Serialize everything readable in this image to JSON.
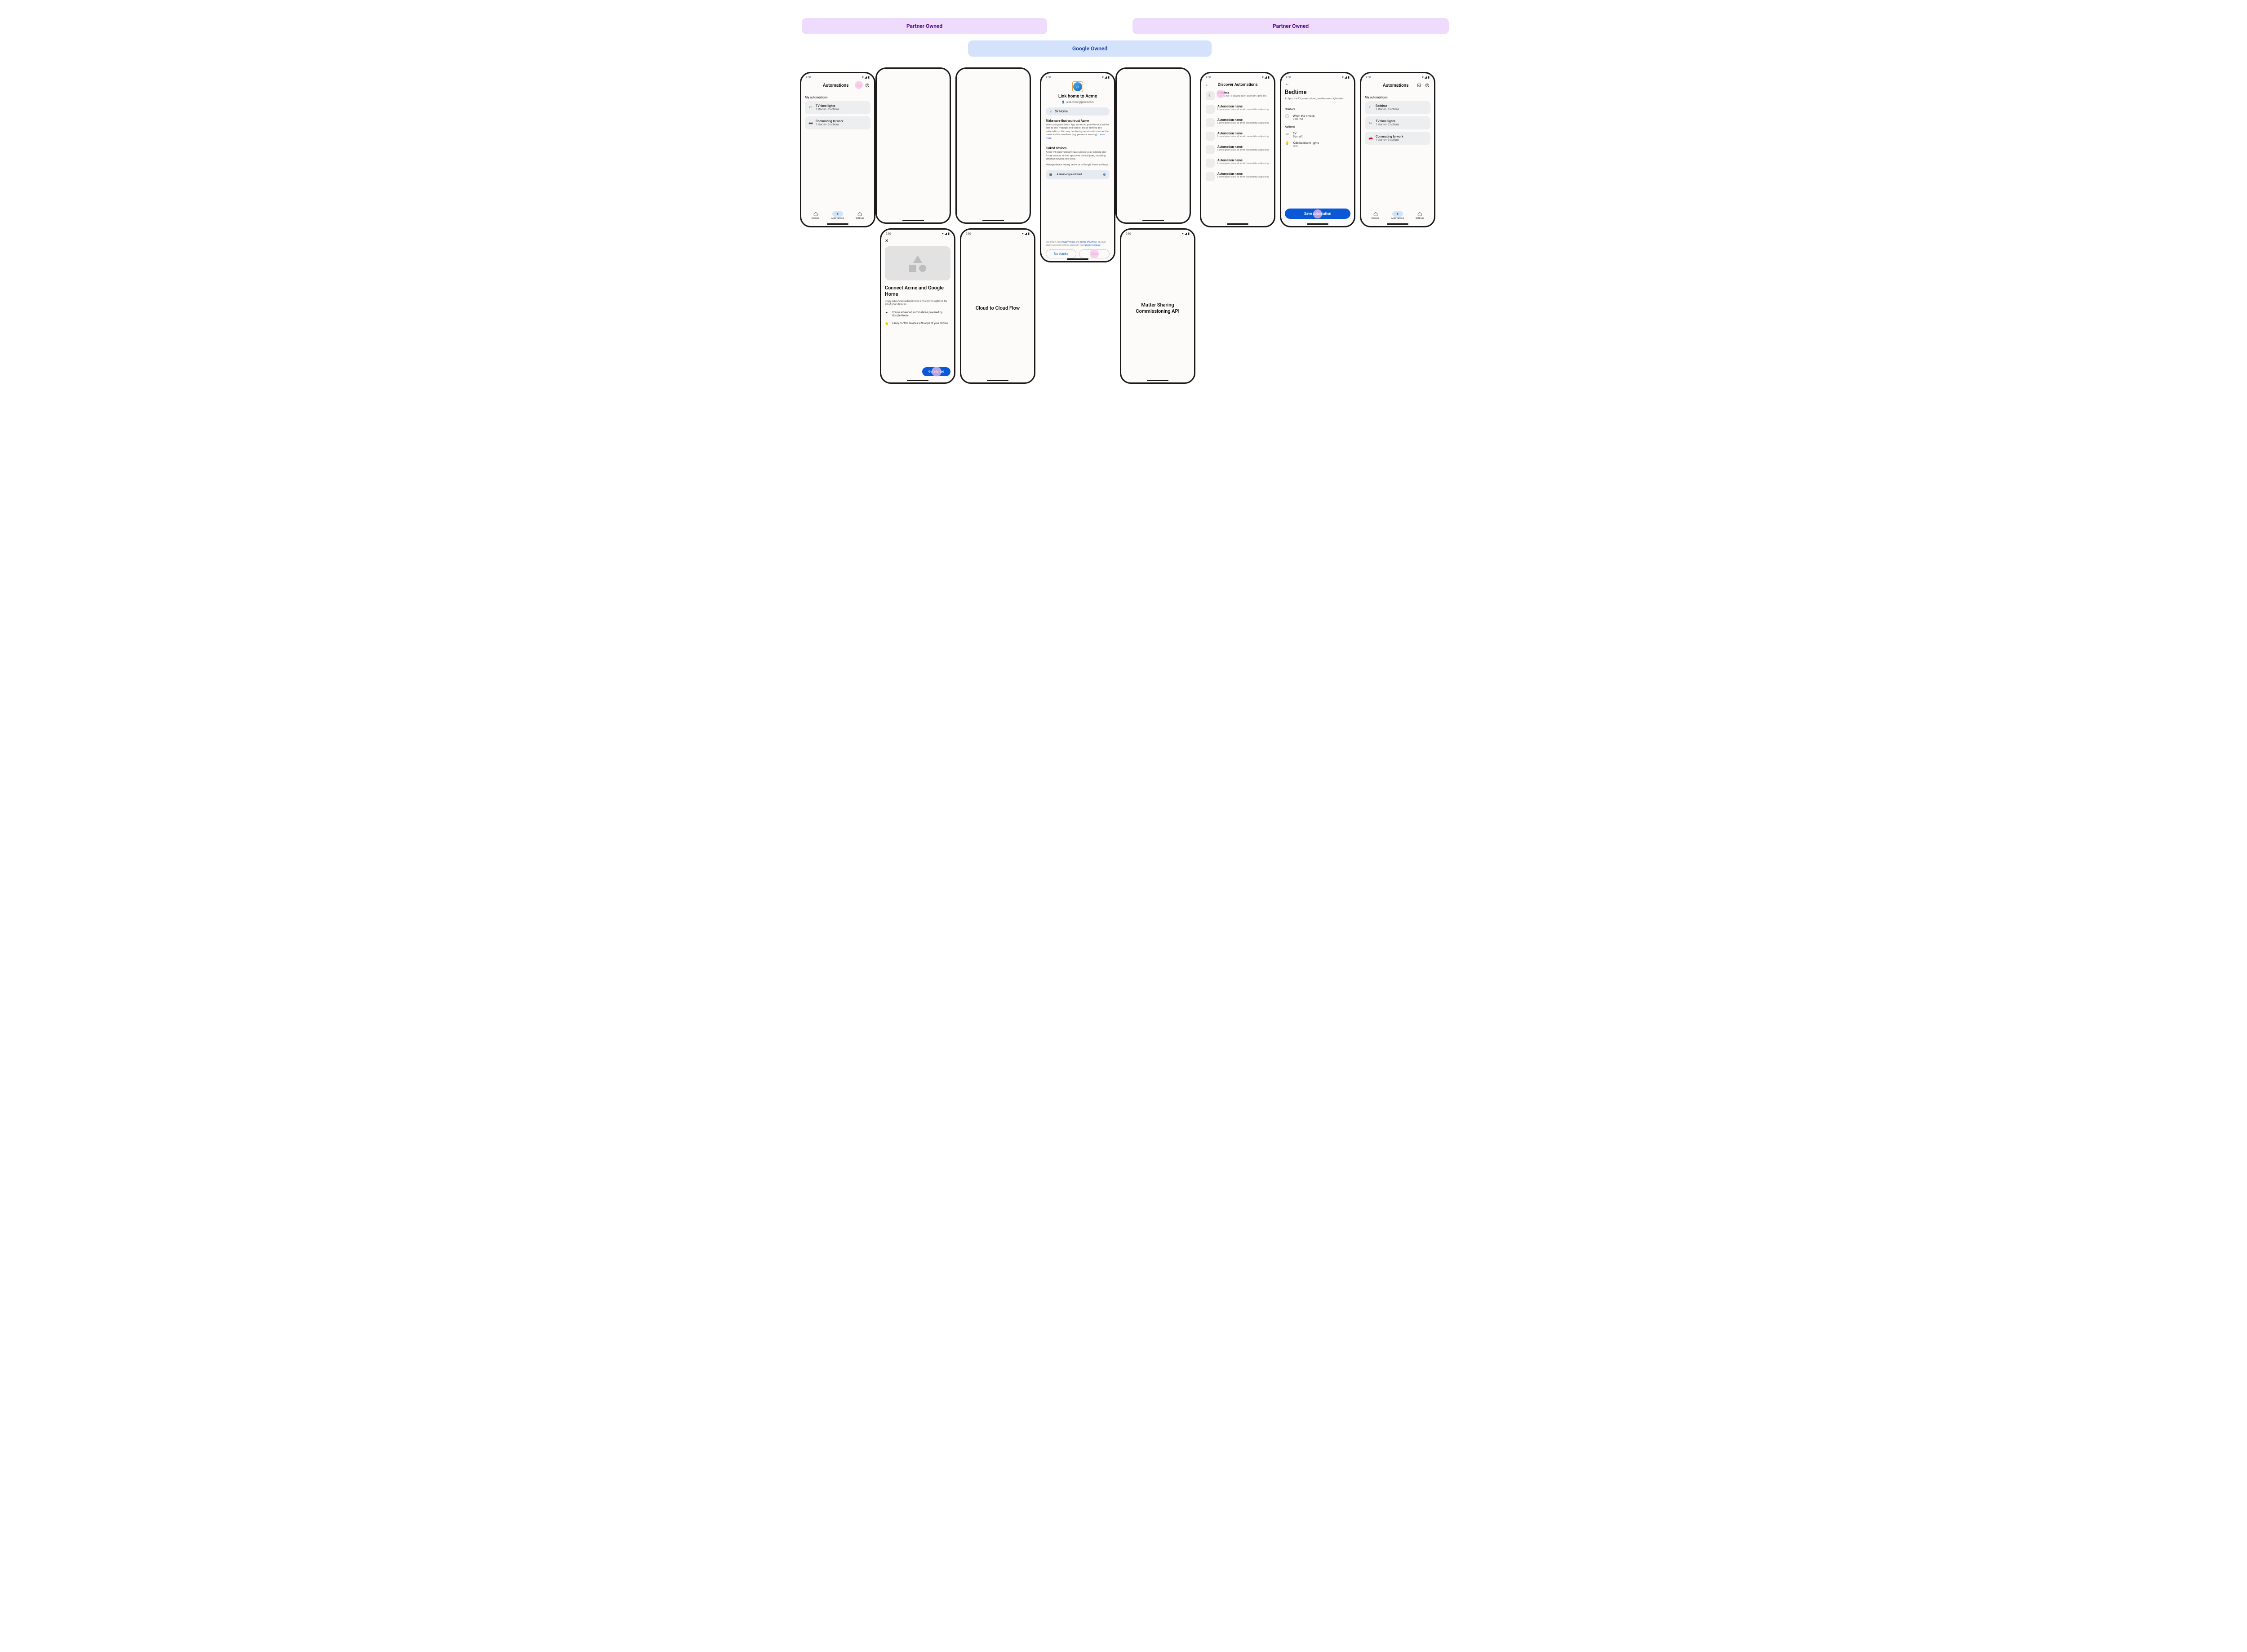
{
  "labels": {
    "partner": "Partner Owned",
    "google": "Google Owned"
  },
  "status": {
    "time": "9:30"
  },
  "screen1": {
    "title": "Automations",
    "section": "My automations",
    "items": [
      {
        "icon": "tv",
        "title": "TV time lights",
        "sub": "1 starter • 2 actions"
      },
      {
        "icon": "car",
        "title": "Commuting to work",
        "sub": "1 starter • 3 actions"
      }
    ],
    "nav": {
      "devices": "Devices",
      "automations": "Automations",
      "settings": "Settings"
    }
  },
  "screen2": {
    "title": "Connect Acme and Google Home",
    "sub": "Enjoy advanced automations and control options for all of your devices",
    "features": [
      {
        "icon": "spark",
        "text": "Create advanced automations powered by Google Home"
      },
      {
        "icon": "tap",
        "text": "Easily control devices with apps of your choice"
      }
    ],
    "cta": "Get started"
  },
  "screen3": {
    "title": "Cloud to Cloud Flow"
  },
  "screen4": {
    "title": "Link home to Acme",
    "email": "alex.miller@gmail.com",
    "home_label": "SF Home",
    "trust_title": "Make sure that you trust Acme",
    "trust_body": "When you grant Smart App access to your Home, it will be able to  see, manage, and control those devices and automations. You may be sharing sensitive info about the home and its members (e.g. presence sensing). ",
    "trust_link": "Learn more",
    "linked_title": "Linked devices",
    "linked_body1": "Acme will automatically have access to all existing and future devices in their approved device types, including sensitive devices like locks.",
    "linked_body2": "Manage device linking below or in Google Home settings.",
    "devbox": "4 device types linked",
    "legal_pre": "See Smart App ",
    "legal_pp": "Privacy Policy",
    "legal_and": " and ",
    "legal_tos": "Terms of Service",
    "legal_mid": ". You can always see and remove access in your ",
    "legal_ga": "Google Account",
    "legal_end": ".",
    "no_thanks": "No thanks",
    "allow": "Allow"
  },
  "screen5": {
    "title": "Matter Sharing Commissioning API"
  },
  "screen6": {
    "title": "Discover Automations",
    "first": {
      "title": "Bedtime",
      "sub": "At 9pm, the TV powers down, bedroom lights dim."
    },
    "generic": {
      "title": "Automation name",
      "sub": "Lorem ipsum dolor sit amet, consectetur adipiscing."
    },
    "repeat_count": 6
  },
  "screen7": {
    "title": "Bedtime",
    "sub": "At 9pm, the TV powers down, and bedroom lights dim.",
    "starters_label": "Starters",
    "starter": {
      "line1": "When the time is",
      "line2": "9:00 PM"
    },
    "actions_label": "Actions",
    "actions": [
      {
        "icon": "tv",
        "line1": "TV",
        "line2": "Turn off"
      },
      {
        "icon": "bulb",
        "line1": "Kids bedroom lights",
        "line2": "Dim"
      }
    ],
    "cta": "Save automation"
  },
  "screen8": {
    "title": "Automations",
    "section": "My automations",
    "items": [
      {
        "icon": "moon",
        "title": "Bedtime",
        "sub": "1 starter • 2 actions"
      },
      {
        "icon": "tv",
        "title": "TV time lights",
        "sub": "1 starter • 2 actions"
      },
      {
        "icon": "car",
        "title": "Commuting to work",
        "sub": "1 starter • 3 actions"
      }
    ],
    "nav": {
      "devices": "Devices",
      "automations": "Automations",
      "settings": "Settings"
    }
  }
}
